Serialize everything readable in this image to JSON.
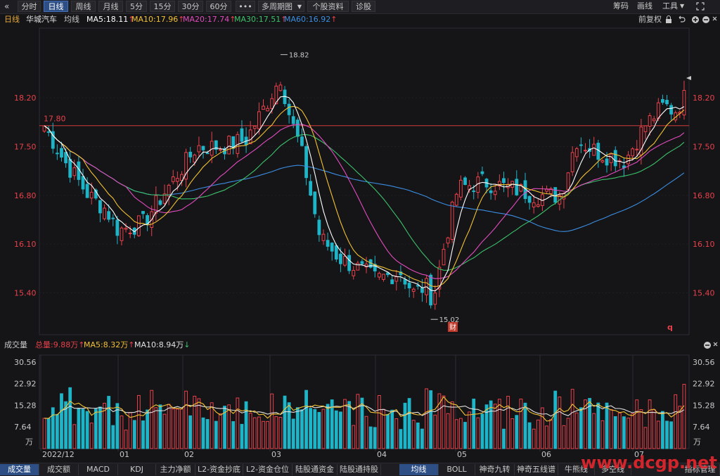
{
  "toolbar": {
    "back_icon": "«",
    "period_tabs": [
      "分时",
      "日线",
      "周线",
      "月线",
      "5分",
      "15分",
      "30分",
      "60分"
    ],
    "active_tab": "日线",
    "more_label": "•••",
    "multi_period_label": "多周期图",
    "dropdown_icon": "▼",
    "info_label": "个股资料",
    "diagnose_label": "诊股",
    "chip_label": "筹码",
    "draw_label": "画线",
    "tools_label": "工具",
    "tools_icon": "▼"
  },
  "ma_bar": {
    "period": "日线",
    "stock_name": "华城汽车",
    "indicator": "均线",
    "ma5": "MA5:18.11",
    "ma10": "MA10:17.96",
    "ma20": "MA20:17.74",
    "ma30": "MA30:17.51",
    "ma60": "MA60:16.92",
    "up_arrow": "↑",
    "adjust_label": "前复权",
    "colors": {
      "ma5": "#ffffff",
      "ma10": "#f2c132",
      "ma20": "#e14bbd",
      "ma30": "#3cc16a",
      "ma60": "#3b8de0"
    }
  },
  "volume_bar": {
    "label": "成交量",
    "total": "总量:9.88万",
    "ma5": "MA5:8.32万",
    "ma10": "MA10:8.94万",
    "up_arrow": "↑",
    "down_arrow": "↓"
  },
  "bottom_tabs": [
    "成交量",
    "成交额",
    "MACD",
    "KDJ",
    "主力净额",
    "L2-资金抄底",
    "L2-资金仓位",
    "陆股通资金",
    "陆股通持股"
  ],
  "bottom_tabs_right": [
    "均线",
    "BOLL",
    "神奇九转",
    "神奇五线谱",
    "牛熊线",
    "多空线"
  ],
  "settings_label": "指标管理",
  "watermark": "www.dcgp.net",
  "chart_data": {
    "type": "candlestick",
    "price_axis": {
      "ticks": [
        "18.20",
        "17.50",
        "16.80",
        "16.10",
        "15.40"
      ],
      "min": 14.8,
      "max": 19.2
    },
    "volume_axis": {
      "ticks": [
        "30.56",
        "22.92",
        "15.28",
        "7.64"
      ],
      "unit": "万",
      "max": 33
    },
    "x_ticks": [
      "2022/12",
      "01",
      "02",
      "03",
      "04",
      "05",
      "06",
      "07"
    ],
    "reference_line": {
      "value": 17.8,
      "label": "17.80"
    },
    "high_label": "18.82",
    "low_label": "15.02",
    "event_markers": [
      "财",
      "q"
    ],
    "up_color": "#e8414a",
    "down_color": "#1fb5c8",
    "ma_colors": {
      "ma5": "#ffffff",
      "ma10": "#f2c132",
      "ma20": "#e14bbd",
      "ma30": "#3cc16a",
      "ma60": "#3b8de0"
    }
  }
}
